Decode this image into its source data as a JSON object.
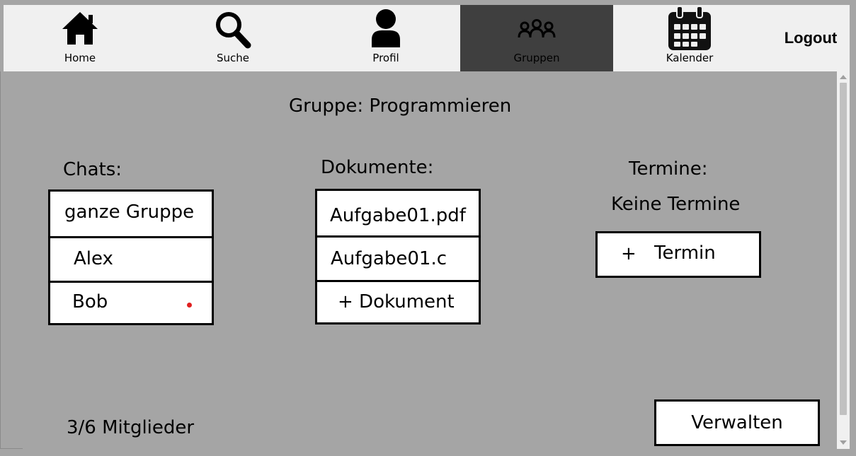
{
  "nav": {
    "items": [
      {
        "label": "Home",
        "icon": "home-icon"
      },
      {
        "label": "Suche",
        "icon": "search-icon"
      },
      {
        "label": "Profil",
        "icon": "user-icon"
      },
      {
        "label": "Gruppen",
        "icon": "group-icon",
        "active": true
      },
      {
        "label": "Kalender",
        "icon": "calendar-icon"
      }
    ],
    "logout": "Logout"
  },
  "group": {
    "title": "Gruppe: Programmieren",
    "members": "3/6 Mitglieder",
    "manage_button": "Verwalten"
  },
  "chats": {
    "heading": "Chats:",
    "items": [
      {
        "label": "ganze Gruppe",
        "unread": false
      },
      {
        "label": "Alex",
        "unread": false
      },
      {
        "label": "Bob",
        "unread": true
      }
    ]
  },
  "documents": {
    "heading": "Dokumente:",
    "items": [
      "Aufgabe01.pdf",
      "Aufgabe01.c"
    ],
    "add_label": "+ Dokument"
  },
  "appointments": {
    "heading": "Termine:",
    "empty_text": "Keine Termine",
    "add_plus": "+",
    "add_label": "Termin"
  },
  "colors": {
    "background": "#a5a5a5",
    "navbar": "#f0f0f0",
    "active_tab": "#3f3f3f",
    "unread_dot": "#e02020"
  }
}
